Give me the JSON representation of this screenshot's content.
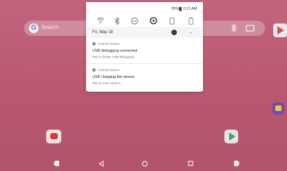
{
  "colors": {
    "wallpaper": "#b85a73",
    "shade_bg": "#ffffff",
    "accent": "#3a3a3a"
  },
  "home_screen": {
    "search_bar": {
      "logo_text": "G",
      "hint": "Search",
      "icons": [
        "google-icon",
        "mic-icon",
        "lens-icon"
      ]
    },
    "apps": [
      "play-store-icon",
      "gallery-icon",
      "youtube-icon",
      "play-icon"
    ]
  },
  "notification_shade": {
    "status": {
      "battery_percent": "95%",
      "time": "2:21 AM"
    },
    "quick_settings": [
      "wifi-icon",
      "bluetooth-icon",
      "do-not-disturb-icon",
      "flashlight-icon",
      "rotate-icon",
      "battery-saver-icon"
    ],
    "date": "Fri, May 18",
    "notifications": [
      {
        "app": "Android System",
        "title": "USB debugging connected",
        "body": "Tap to disable USB debugging."
      },
      {
        "app": "Android System",
        "title": "USB charging this device",
        "body": "Tap for more options."
      }
    ]
  },
  "nav_bar": {
    "buttons": [
      "overview-left-icon",
      "back-icon",
      "home-icon",
      "recents-icon",
      "overview-right-icon"
    ]
  }
}
